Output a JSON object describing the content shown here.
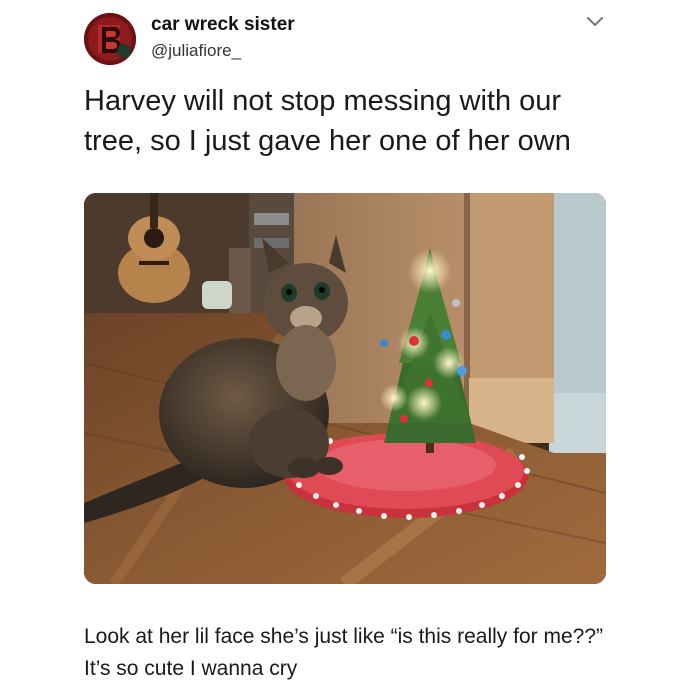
{
  "author": {
    "display_name": "car wreck sister",
    "handle": "@juliafiore_"
  },
  "icons": {
    "more": "chevron-down-icon"
  },
  "post": {
    "text": "Harvey will not stop messing with our tree, so I just gave her one of her own"
  },
  "caption": {
    "text": "Look at her lil face she’s just like “is this really for me??” It’s so cute I wanna cry"
  }
}
